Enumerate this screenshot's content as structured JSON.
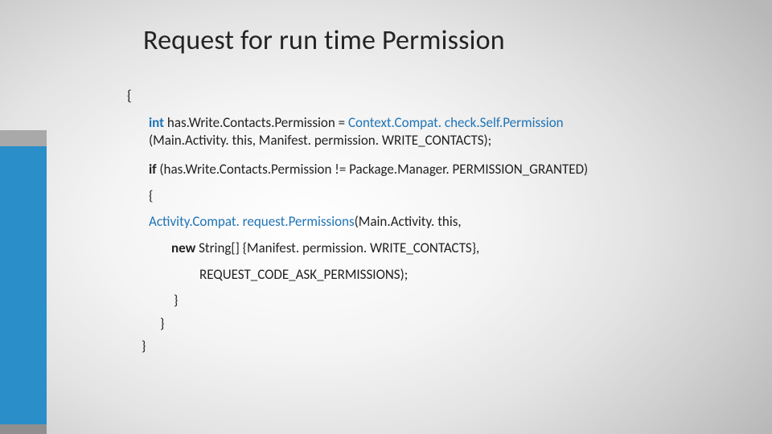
{
  "title": "Request for run time Permission",
  "code": {
    "openBrace": "{",
    "line1_kw": "int ",
    "line1_var": "has.Write.Contacts.Permission = ",
    "line1_call": "Context.Compat. check.Self.Permission",
    "line1b": "(Main.Activity. this, Manifest. permission. WRITE_CONTACTS);",
    "line2_if": "if ",
    "line2_rest": "(has.Write.Contacts.Permission != Package.Manager. PERMISSION_GRANTED)",
    "line3": "{",
    "line4_call": "Activity.Compat. request.Permissions",
    "line4_rest": "(Main.Activity. this,",
    "line5_new": "new ",
    "line5_rest": "String[] {Manifest. permission. WRITE_CONTACTS},",
    "line6": "REQUEST_CODE_ASK_PERMISSIONS);",
    "close1": "}",
    "close2": "}",
    "close3": "}"
  }
}
